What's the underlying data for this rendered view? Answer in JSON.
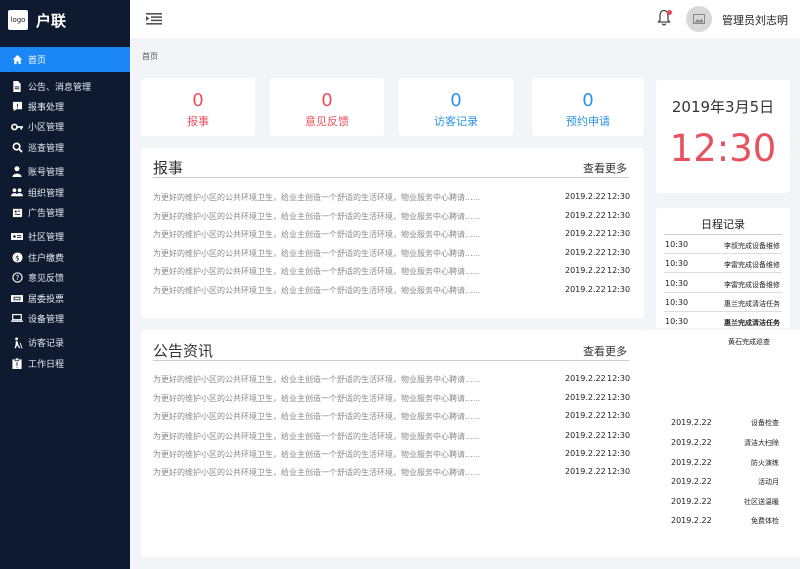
{
  "brand": {
    "logo": "logo",
    "name": "户联"
  },
  "sidebar": {
    "items": [
      {
        "label": "首页",
        "icon": "home-icon"
      },
      {
        "label": "公告、消息管理",
        "icon": "document-icon"
      },
      {
        "label": "报事处理",
        "icon": "alert-icon"
      },
      {
        "label": "小区管理",
        "icon": "key-icon"
      },
      {
        "label": "巡查管理",
        "icon": "search-icon"
      },
      {
        "label": "账号管理",
        "icon": "user-icon"
      },
      {
        "label": "组织管理",
        "icon": "users-icon"
      },
      {
        "label": "广告管理",
        "icon": "folder-icon"
      },
      {
        "label": "社区管理",
        "icon": "id-card-icon"
      },
      {
        "label": "住户缴费",
        "icon": "dollar-icon"
      },
      {
        "label": "意见反馈",
        "icon": "question-icon"
      },
      {
        "label": "居委投票",
        "icon": "ticket-icon"
      },
      {
        "label": "设备管理",
        "icon": "laptop-icon"
      },
      {
        "label": "访客记录",
        "icon": "walker-icon"
      },
      {
        "label": "工作日程",
        "icon": "clipboard-icon"
      }
    ]
  },
  "header": {
    "user_name": "管理员刘志明"
  },
  "breadcrumb": "首页",
  "stats": [
    {
      "value": "0",
      "label": "报事"
    },
    {
      "value": "0",
      "label": "意见反馈"
    },
    {
      "value": "0",
      "label": "访客记录"
    },
    {
      "value": "0",
      "label": "预约申请"
    }
  ],
  "reports": {
    "title": "报事",
    "more": "查看更多",
    "rows": [
      {
        "text": "为更好的维护小区的公共环境卫生，给业主创造一个舒适的生活环境，物业服务中心聘请......",
        "date": "2019.2.22",
        "time": "12:30"
      },
      {
        "text": "为更好的维护小区的公共环境卫生，给业主创造一个舒适的生活环境，物业服务中心聘请......",
        "date": "2019.2.22",
        "time": "12:30"
      },
      {
        "text": "为更好的维护小区的公共环境卫生，给业主创造一个舒适的生活环境，物业服务中心聘请......",
        "date": "2019.2.22",
        "time": "12:30"
      },
      {
        "text": "为更好的维护小区的公共环境卫生，给业主创造一个舒适的生活环境，物业服务中心聘请......",
        "date": "2019.2.22",
        "time": "12:30"
      },
      {
        "text": "为更好的维护小区的公共环境卫生，给业主创造一个舒适的生活环境，物业服务中心聘请......",
        "date": "2019.2.22",
        "time": "12:30"
      },
      {
        "text": "为更好的维护小区的公共环境卫生，给业主创造一个舒适的生活环境，物业服务中心聘请......",
        "date": "2019.2.22",
        "time": "12:30"
      }
    ]
  },
  "notices": {
    "title": "公告资讯",
    "more": "查看更多",
    "rows": [
      {
        "text": "为更好的维护小区的公共环境卫生，给业主创造一个舒适的生活环境，物业服务中心聘请......",
        "date": "2019.2.22",
        "time": "12:30"
      },
      {
        "text": "为更好的维护小区的公共环境卫生，给业主创造一个舒适的生活环境，物业服务中心聘请......",
        "date": "2019.2.22",
        "time": "12:30"
      },
      {
        "text": "为更好的维护小区的公共环境卫生，给业主创造一个舒适的生活环境，物业服务中心聘请......",
        "date": "2019.2.22",
        "time": "12:30"
      },
      {
        "text": "为更好的维护小区的公共环境卫生，给业主创造一个舒适的生活环境，物业服务中心聘请......",
        "date": "2019.2.22",
        "time": "12:30"
      },
      {
        "text": "为更好的维护小区的公共环境卫生，给业主创造一个舒适的生活环境，物业服务中心聘请......",
        "date": "2019.2.22",
        "time": "12:30"
      },
      {
        "text": "为更好的维护小区的公共环境卫生，给业主创造一个舒适的生活环境，物业服务中心聘请......",
        "date": "2019.2.22",
        "time": "12:30"
      }
    ]
  },
  "clock": {
    "date": "2019年3月5日",
    "time": "12:30"
  },
  "schedule": {
    "title": "日程记录",
    "rows": [
      {
        "time": "10:30",
        "event": "李叔完成设备维修"
      },
      {
        "time": "10:30",
        "event": "李雷完成设备维修"
      },
      {
        "time": "10:30",
        "event": "李雷完成设备维修"
      },
      {
        "time": "10:30",
        "event": "惠兰完成清洁任务"
      },
      {
        "time": "10:30",
        "event": "惠兰完成清洁任务"
      }
    ],
    "extra": "黄石完成巡查"
  },
  "events": [
    {
      "date": "2019.2.22",
      "name": "设备检查"
    },
    {
      "date": "2019.2.22",
      "name": "清洁大扫除"
    },
    {
      "date": "2019.2.22",
      "name": "防火演练"
    },
    {
      "date": "2019.2.22",
      "name": "活动月"
    },
    {
      "date": "2019.2.22",
      "name": "社区送温暖"
    },
    {
      "date": "2019.2.22",
      "name": "免费体检"
    }
  ],
  "colors": {
    "sidebar_bg": "#0e1a2f",
    "active": "#1b86f5",
    "alert_red": "#e8515e",
    "info_blue": "#2b93e8"
  }
}
